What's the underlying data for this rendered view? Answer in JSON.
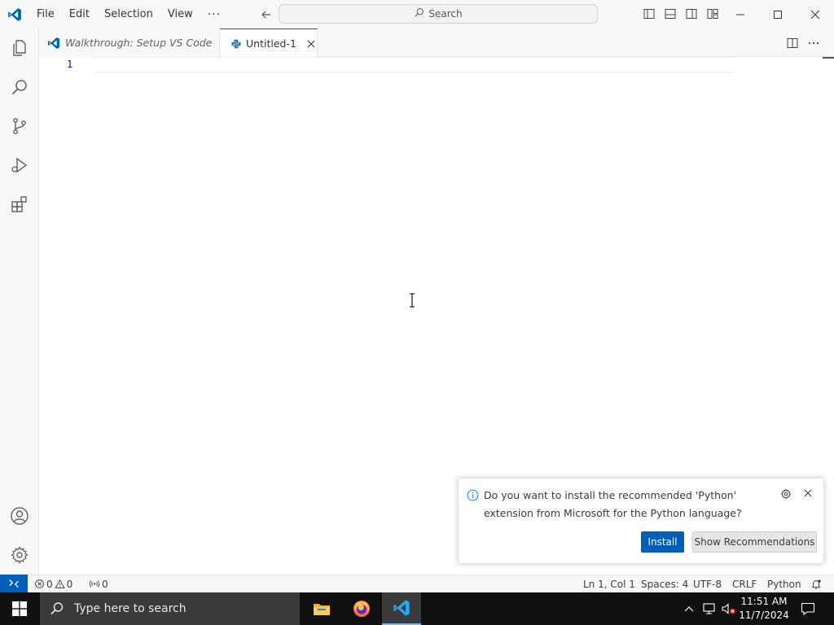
{
  "titlebar": {
    "menu": [
      "File",
      "Edit",
      "Selection",
      "View"
    ],
    "more": "···",
    "search_label": "Search"
  },
  "tabs": [
    {
      "label": "Walkthrough: Setup VS Code",
      "icon": "vscode-icon",
      "active": false
    },
    {
      "label": "Untitled-1",
      "icon": "python-icon",
      "active": true
    }
  ],
  "editor": {
    "line_number": "1"
  },
  "notification": {
    "message": "Do you want to install the recommended 'Python' extension from Microsoft for the Python language?",
    "install_label": "Install",
    "recommendations_label": "Show Recommendations"
  },
  "statusbar": {
    "errors": "0",
    "warnings": "0",
    "ports": "0",
    "position": "Ln 1, Col 1",
    "spaces": "Spaces: 4",
    "encoding": "UTF-8",
    "eol": "CRLF",
    "language": "Python"
  },
  "taskbar": {
    "search_placeholder": "Type here to search",
    "time": "11:51 AM",
    "date": "11/7/2024"
  },
  "colors": {
    "accent": "#005fb8",
    "statusbar_bg": "#f8f8f8",
    "taskbar_bg": "#101010"
  }
}
